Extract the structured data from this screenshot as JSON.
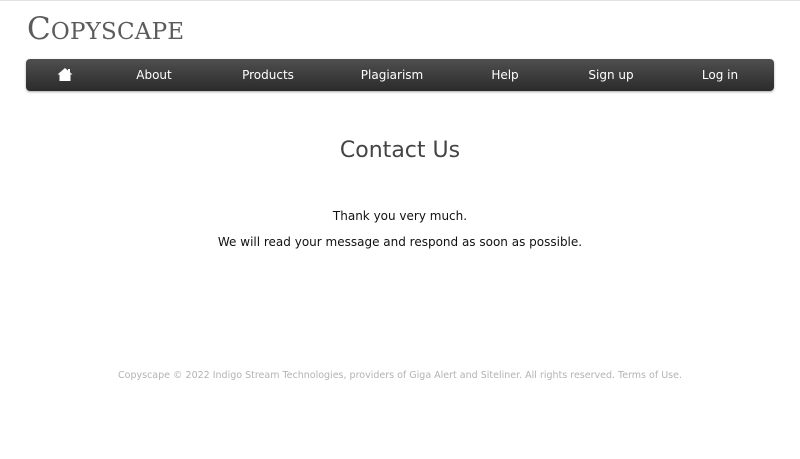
{
  "logo": {
    "cap": "C",
    "rest": "OPYSCAPE"
  },
  "nav": {
    "home_icon": "home-icon",
    "items": [
      {
        "label": "About"
      },
      {
        "label": "Products"
      },
      {
        "label": "Plagiarism"
      },
      {
        "label": "Help"
      },
      {
        "label": "Sign up"
      },
      {
        "label": "Log in"
      }
    ]
  },
  "main": {
    "heading": "Contact Us",
    "thanks": "Thank you very much.",
    "message": "We will read your message and respond as soon as possible."
  },
  "footer": {
    "prefix": "Copyscape © 2022 ",
    "company": "Indigo Stream Technologies",
    "middle": ", providers of ",
    "giga": "Giga Alert",
    "and": " and ",
    "siteliner": "Siteliner",
    "suffix": ". All rights reserved. ",
    "terms": "Terms of Use",
    "end": "."
  },
  "colors": {
    "nav_bar": "#3a3a3a",
    "heading": "#444444",
    "footer_text": "#b3b3b3"
  }
}
